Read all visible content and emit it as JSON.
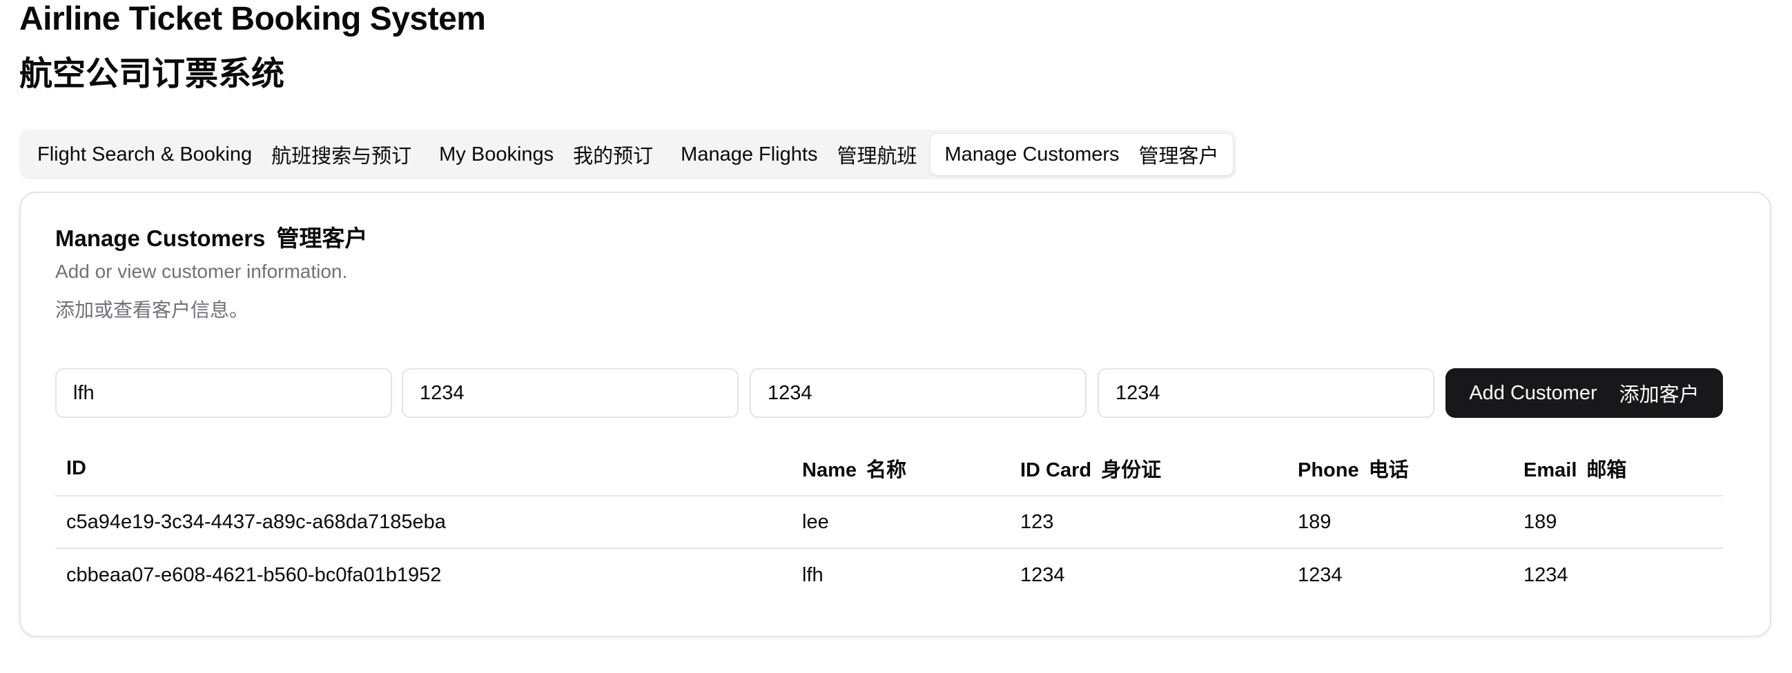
{
  "header": {
    "title_en": "Airline Ticket Booking System",
    "title_zh": "航空公司订票系统"
  },
  "tabs": [
    {
      "label_en": "Flight Search & Booking",
      "label_zh": "航班搜索与预订",
      "active": false
    },
    {
      "label_en": "My Bookings",
      "label_zh": "我的预订",
      "active": false
    },
    {
      "label_en": "Manage Flights",
      "label_zh": "管理航班",
      "active": false
    },
    {
      "label_en": "Manage Customers",
      "label_zh": "管理客户",
      "active": true
    }
  ],
  "card": {
    "title_en": "Manage Customers",
    "title_zh": "管理客户",
    "desc_en": "Add or view customer information.",
    "desc_zh": "添加或查看客户信息。"
  },
  "form": {
    "name_value": "lfh",
    "idcard_value": "1234",
    "phone_value": "1234",
    "email_value": "1234",
    "add_button_en": "Add Customer",
    "add_button_zh": "添加客户"
  },
  "table": {
    "headers": {
      "id": "ID",
      "name_en": "Name",
      "name_zh": "名称",
      "idcard_en": "ID Card",
      "idcard_zh": "身份证",
      "phone_en": "Phone",
      "phone_zh": "电话",
      "email_en": "Email",
      "email_zh": "邮箱"
    },
    "rows": [
      {
        "id": "c5a94e19-3c34-4437-a89c-a68da7185eba",
        "name": "lee",
        "idcard": "123",
        "phone": "189",
        "email": "189"
      },
      {
        "id": "cbbeaa07-e608-4621-b560-bc0fa01b1952",
        "name": "lfh",
        "idcard": "1234",
        "phone": "1234",
        "email": "1234"
      }
    ]
  },
  "colors": {
    "primary_button": "#18181b",
    "muted_text": "#71717a",
    "border": "#e4e4e7",
    "tabs_bg": "#f4f4f5"
  }
}
